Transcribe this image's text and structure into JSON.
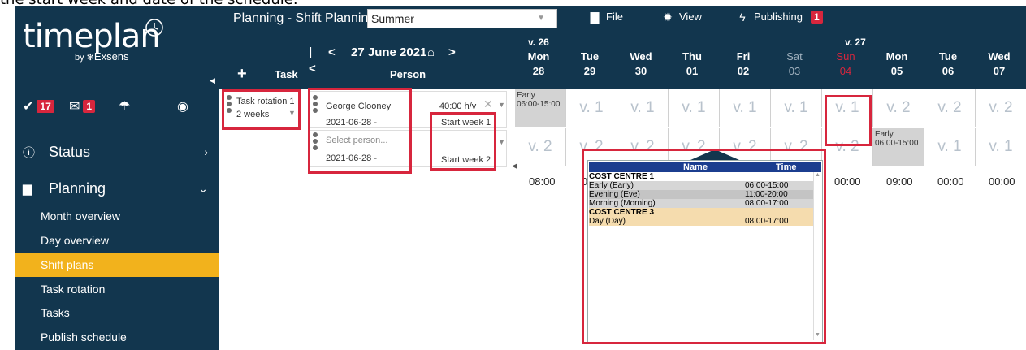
{
  "caption": "the start week and date of the schedule.",
  "app": {
    "logo_text": "timeplan",
    "logo_by": "by",
    "logo_brand": "Exsens",
    "header_title": "Planning - Shift Planning",
    "plan_value": "Summer",
    "menu": [
      {
        "label": "File",
        "icon": "file-icon"
      },
      {
        "label": "View",
        "icon": "gear-icon"
      },
      {
        "label": "Publishing",
        "icon": "lightning-icon",
        "badge": "1"
      }
    ]
  },
  "sidebar": {
    "badges": [
      {
        "icon": "check-icon",
        "count": "17"
      },
      {
        "icon": "mail-icon",
        "count": "1"
      },
      {
        "icon": "beach-umbrella-icon",
        "count": ""
      },
      {
        "icon": "owl-icon",
        "count": ""
      }
    ],
    "sections": [
      {
        "label": "Status",
        "icon": "info-icon",
        "chevron": "chevron-right-icon"
      },
      {
        "label": "Planning",
        "icon": "briefcase-icon",
        "chevron": "chevron-down-icon"
      }
    ],
    "items": [
      {
        "label": "Month overview",
        "active": false
      },
      {
        "label": "Day overview",
        "active": false
      },
      {
        "label": "Shift plans",
        "active": true
      },
      {
        "label": "Task rotation",
        "active": false
      },
      {
        "label": "Tasks",
        "active": false
      },
      {
        "label": "Publish schedule",
        "active": false
      }
    ]
  },
  "nav": {
    "date": "27 June 2021",
    "first_label": "|<",
    "prev_label": "<",
    "next_label": ">"
  },
  "columns": {
    "add": "+",
    "task": "Task",
    "person": "Person"
  },
  "weeks": [
    {
      "label": "v. 26"
    },
    {
      "label": "v. 27"
    }
  ],
  "days": [
    {
      "name": "Mon",
      "num": "28",
      "style": "normal"
    },
    {
      "name": "Tue",
      "num": "29",
      "style": "normal"
    },
    {
      "name": "Wed",
      "num": "30",
      "style": "normal"
    },
    {
      "name": "Thu",
      "num": "01",
      "style": "normal"
    },
    {
      "name": "Fri",
      "num": "02",
      "style": "normal"
    },
    {
      "name": "Sat",
      "num": "03",
      "style": "grey"
    },
    {
      "name": "Sun",
      "num": "04",
      "style": "red"
    },
    {
      "name": "Mon",
      "num": "05",
      "style": "normal"
    },
    {
      "name": "Tue",
      "num": "06",
      "style": "normal"
    },
    {
      "name": "Wed",
      "num": "07",
      "style": "normal"
    }
  ],
  "rows": [
    {
      "task": "Task rotation 1",
      "period": "2 weeks",
      "person": "George Clooney",
      "date": "2021-06-28",
      "hours": "40:00 h/v",
      "start_week": "Start week 1",
      "cells": [
        "Early 06:00-15:00",
        "v. 1",
        "v. 1",
        "v. 1",
        "v. 1",
        "v. 1",
        "v. 1",
        "v. 2",
        "v. 2",
        "v. 2"
      ]
    },
    {
      "task": "",
      "period": "",
      "person": "Select person...",
      "date": "2021-06-28",
      "hours": "",
      "start_week": "Start week 2",
      "cells": [
        "v. 2",
        "v. 2",
        "v. 2",
        "v. 2",
        "v. 2",
        "v. 2",
        "v. 2",
        "Early 06:00-15:00",
        "v. 1",
        "v. 1"
      ]
    }
  ],
  "times": [
    "08:00",
    "00",
    "00:00",
    "09:00",
    "00:00",
    "00:00"
  ],
  "popup": {
    "col_name": "Name",
    "col_time": "Time",
    "groups": [
      {
        "label": "COST CENTRE 1",
        "rows": [
          {
            "name": "Early (Early)",
            "time": "06:00-15:00"
          },
          {
            "name": "Evening (Eve)",
            "time": "11:00-20:00"
          },
          {
            "name": "Morning (Morning)",
            "time": "08:00-17:00"
          }
        ]
      },
      {
        "label": "COST CENTRE 3",
        "rows": [
          {
            "name": "Day (Day)",
            "time": "08:00-17:00"
          }
        ]
      }
    ]
  },
  "colors": {
    "navy": "#12364e",
    "active": "#f2b21c",
    "highlight": "#d7263d",
    "popup_header": "#1b3d8f"
  }
}
